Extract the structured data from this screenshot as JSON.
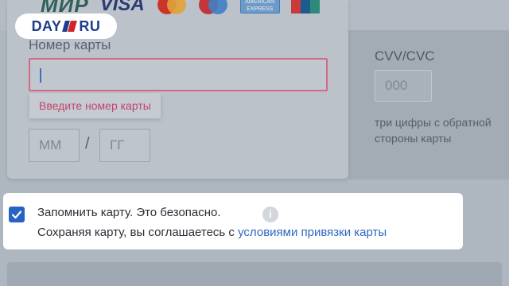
{
  "brand_logos": {
    "mir": "МИР",
    "visa": "VISA",
    "amex": "AMERICAN EXPRESS",
    "unionpay": "UnionPay",
    "icons": [
      "mir-logo",
      "visa-logo",
      "mastercard-logo",
      "maestro-logo",
      "amex-logo",
      "unionpay-logo"
    ]
  },
  "watermark": {
    "text": "DAY",
    "suffix": "RU"
  },
  "card_form": {
    "card_number_label": "Номер карты",
    "card_number_value": "",
    "error_tooltip": "Введите номер карты",
    "expiry_month_placeholder": "ММ",
    "expiry_separator": "/",
    "expiry_year_placeholder": "ГГ",
    "cvv_label": "CVV/CVC",
    "cvv_placeholder": "000",
    "cvv_hint": "три цифры с обратной стороны карты"
  },
  "remember_card": {
    "checked": true,
    "label": "Запомнить карту. Это безопасно.",
    "info_icon": "i",
    "consent_prefix": "Сохраняя карту, вы соглашаетесь с ",
    "consent_link": "условиями привязки карты"
  },
  "colors": {
    "accent": "#2563c4",
    "error": "#c2446a",
    "link": "#2f67c2"
  }
}
